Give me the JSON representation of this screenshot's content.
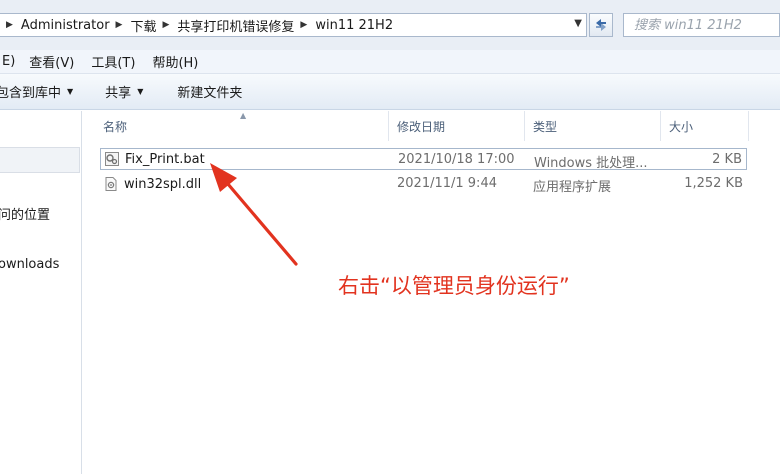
{
  "address_bar": {
    "breadcrumbs": [
      "Administrator",
      "下载",
      "共享打印机错误修复",
      "win11 21H2"
    ],
    "search_placeholder": "搜索 win11 21H2"
  },
  "menu": {
    "items": [
      "E)",
      "查看(V)",
      "工具(T)",
      "帮助(H)"
    ]
  },
  "toolbar": {
    "include_label": "包含到库中",
    "share_label": "共享",
    "new_folder_label": "新建文件夹"
  },
  "navigation": {
    "items": [
      "问的位置",
      "ownloads"
    ]
  },
  "columns": {
    "name": "名称",
    "date": "修改日期",
    "type": "类型",
    "size": "大小"
  },
  "files": [
    {
      "name": "Fix_Print.bat",
      "date": "2021/10/18 17:00",
      "type": "Windows 批处理...",
      "size": "2 KB",
      "icon": "batch-file-icon",
      "selected": true
    },
    {
      "name": "win32spl.dll",
      "date": "2021/11/1 9:44",
      "type": "应用程序扩展",
      "size": "1,252 KB",
      "icon": "dll-file-icon",
      "selected": false
    }
  ],
  "annotation": {
    "text": "右击“以管理员身份运行”",
    "color": "#e2331f"
  }
}
